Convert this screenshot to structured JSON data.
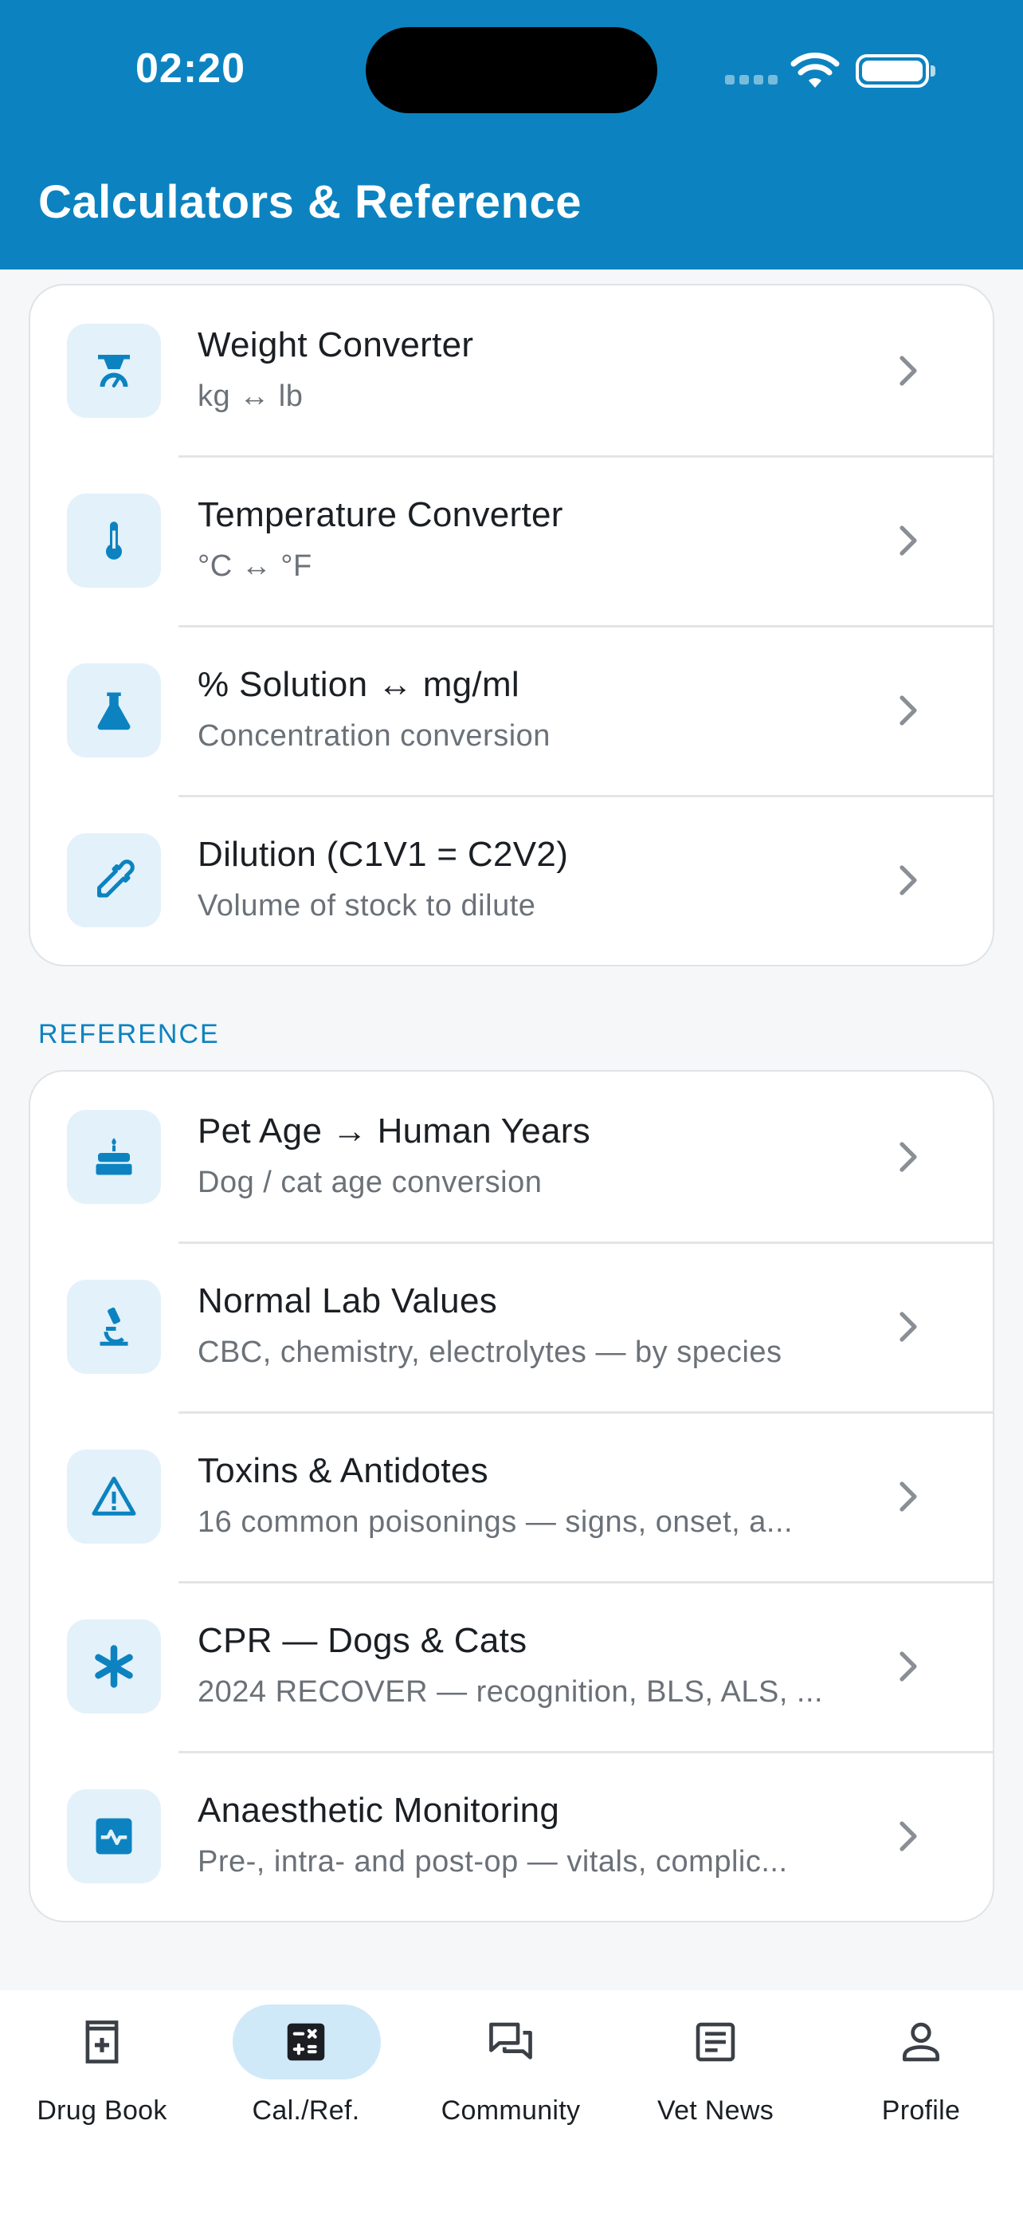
{
  "status_bar": {
    "time": "02:20"
  },
  "header": {
    "title": "Calculators & Reference"
  },
  "colors": {
    "brand": "#0c83c0",
    "icon_bg": "#e3f1fa",
    "active_tab": "#cfe9f8"
  },
  "calculators": [
    {
      "icon": "weight-scale-icon",
      "title": "Weight Converter",
      "subtitle": "kg ↔ lb"
    },
    {
      "icon": "thermometer-icon",
      "title": "Temperature Converter",
      "subtitle": "°C ↔ °F"
    },
    {
      "icon": "flask-icon",
      "title": "% Solution ↔ mg/ml",
      "subtitle": "Concentration conversion"
    },
    {
      "icon": "dropper-icon",
      "title": "Dilution (C1V1 = C2V2)",
      "subtitle": "Volume of stock to dilute"
    }
  ],
  "reference": {
    "label": "REFERENCE",
    "items": [
      {
        "icon": "cake-icon",
        "title": "Pet Age → Human Years",
        "subtitle": "Dog / cat age conversion"
      },
      {
        "icon": "microscope-icon",
        "title": "Normal Lab Values",
        "subtitle": "CBC, chemistry, electrolytes — by species"
      },
      {
        "icon": "warning-icon",
        "title": "Toxins & Antidotes",
        "subtitle": "16 common poisonings — signs, onset, a..."
      },
      {
        "icon": "asterisk-icon",
        "title": "CPR — Dogs & Cats",
        "subtitle": "2024 RECOVER — recognition, BLS, ALS, ..."
      },
      {
        "icon": "heart-monitor-icon",
        "title": "Anaesthetic Monitoring",
        "subtitle": "Pre-, intra- and post-op — vitals, complic..."
      }
    ]
  },
  "tabs": [
    {
      "icon": "drug-book-icon",
      "label": "Drug Book",
      "active": false
    },
    {
      "icon": "calculator-icon",
      "label": "Cal./Ref.",
      "active": true
    },
    {
      "icon": "community-icon",
      "label": "Community",
      "active": false
    },
    {
      "icon": "news-icon",
      "label": "Vet News",
      "active": false
    },
    {
      "icon": "profile-icon",
      "label": "Profile",
      "active": false
    }
  ]
}
